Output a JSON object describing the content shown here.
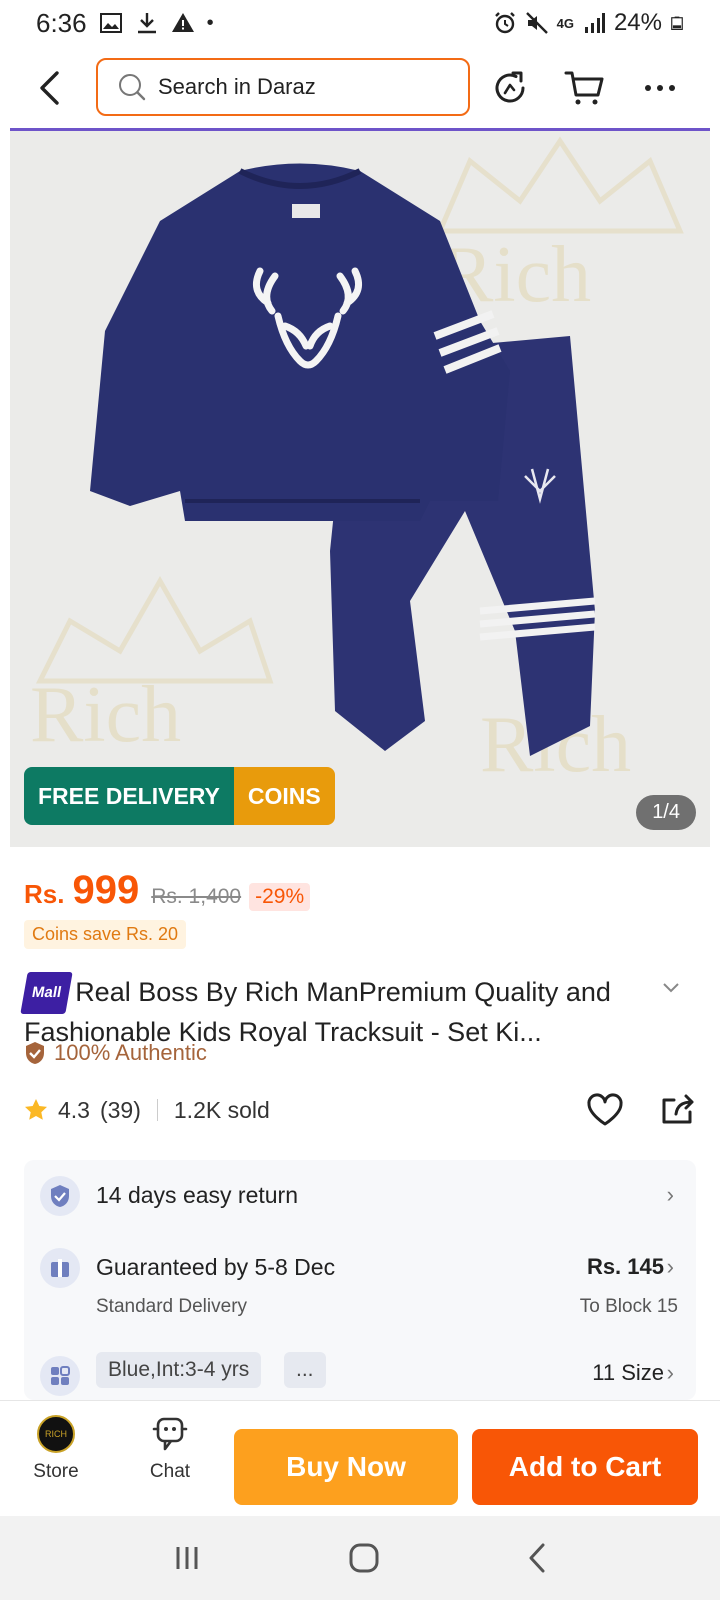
{
  "status_bar": {
    "time": "6:36",
    "battery": "24%",
    "network": "4G"
  },
  "header": {
    "search_placeholder": "Search in Daraz"
  },
  "gallery": {
    "badge_delivery": "FREE DELIVERY",
    "badge_coins": "COINS",
    "pager": "1/4",
    "watermark": "Rich"
  },
  "price": {
    "currency": "Rs.",
    "current": "999",
    "original": "Rs. 1,400",
    "discount": "-29%",
    "coins_save": "Coins save Rs. 20"
  },
  "product": {
    "mall_label": "Mall",
    "title": "Real Boss By Rich ManPremium Quality and Fashionable Kids Royal Tracksuit - Set Ki...",
    "authentic": "100% Authentic",
    "rating": "4.3",
    "reviews": "(39)",
    "sold": "1.2K sold"
  },
  "services": {
    "returns": "14 days easy return",
    "delivery_title": "Guaranteed by 5-8 Dec",
    "delivery_sub": "Standard Delivery",
    "delivery_price": "Rs. 145",
    "delivery_to": "To Block 15",
    "variant_chip": "Blue,Int:3-4 yrs",
    "variant_more": "...",
    "sizes": "11 Size"
  },
  "bottom_bar": {
    "store_label": "Store",
    "store_avatar": "RICH",
    "chat_label": "Chat",
    "buy_now": "Buy Now",
    "add_to_cart": "Add to Cart"
  },
  "colors": {
    "accent": "#f85606",
    "buy": "#fda01e",
    "purple": "#6e54c9",
    "navy": "#2d3373"
  }
}
